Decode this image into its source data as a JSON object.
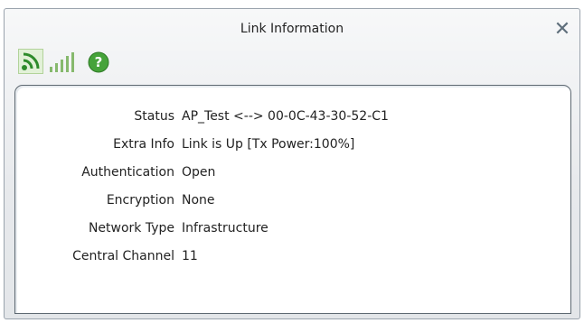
{
  "window": {
    "title": "Link Information"
  },
  "icons": [
    {
      "name": "wifi-icon",
      "color": "#2e8b2b"
    },
    {
      "name": "signal-strength-icon",
      "color": "#7fb566"
    },
    {
      "name": "help-icon",
      "color": "#46a33a"
    }
  ],
  "rows": [
    {
      "label": "Status",
      "value": "AP_Test <--> 00-0C-43-30-52-C1"
    },
    {
      "label": "Extra Info",
      "value": "Link is Up  [Tx Power:100%]"
    },
    {
      "label": "Authentication",
      "value": "Open"
    },
    {
      "label": "Encryption",
      "value": "None"
    },
    {
      "label": "Network Type",
      "value": "Infrastructure"
    },
    {
      "label": "Central Channel",
      "value": "11"
    }
  ]
}
